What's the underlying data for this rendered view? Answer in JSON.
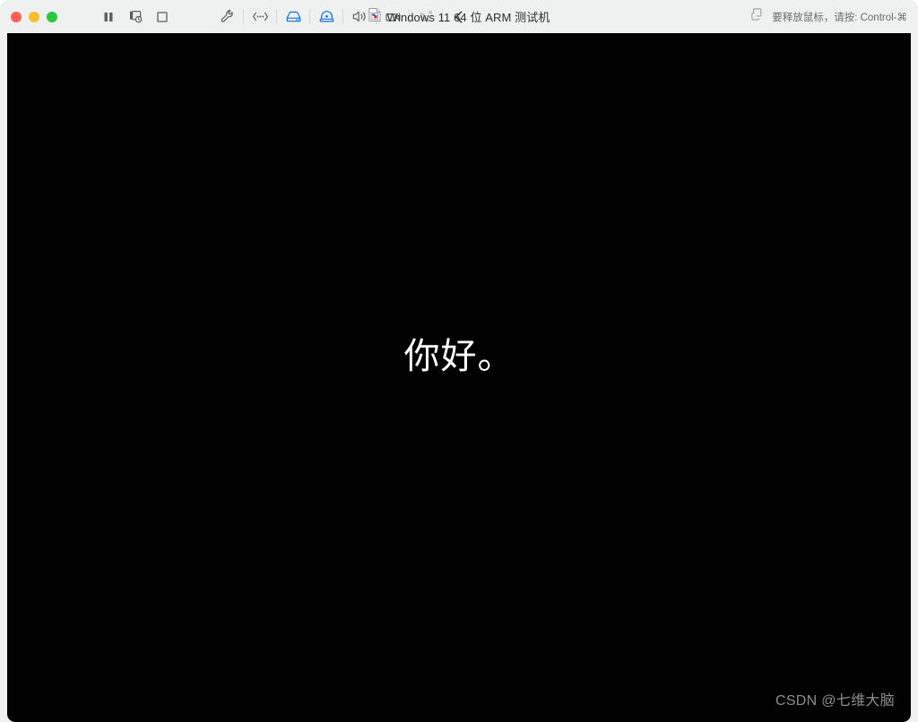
{
  "window": {
    "title": "Windows 11 64 位 ARM 测试机",
    "title_icon": "vm-document-icon",
    "traffic_lights": [
      {
        "name": "close",
        "label": "关闭",
        "color": "#ff5f57"
      },
      {
        "name": "minimize",
        "label": "最小化",
        "color": "#febc2e"
      },
      {
        "name": "maximize",
        "label": "全屏",
        "color": "#28c840"
      }
    ]
  },
  "toolbar": {
    "items": [
      {
        "name": "suspend-button",
        "icon": "pause-icon",
        "label": "挂起",
        "state": "normal"
      },
      {
        "name": "snapshot-button",
        "icon": "snapshot-icon",
        "label": "快照",
        "state": "normal"
      },
      {
        "name": "stop-button",
        "icon": "stop-icon",
        "label": "停止",
        "state": "normal"
      },
      {
        "name": "settings-button",
        "icon": "wrench-icon",
        "label": "设置",
        "state": "normal"
      },
      {
        "name": "network-button",
        "icon": "network-icon",
        "label": "网络适配器",
        "state": "normal"
      },
      {
        "name": "harddisk-button",
        "icon": "hard-drive-icon",
        "label": "硬盘",
        "state": "active"
      },
      {
        "name": "cd-drive-button",
        "icon": "cd-drive-icon",
        "label": "CD/DVD",
        "state": "active"
      },
      {
        "name": "sound-button",
        "icon": "speaker-icon",
        "label": "声卡",
        "state": "normal"
      },
      {
        "name": "camera-button",
        "icon": "camera-icon",
        "label": "摄像头",
        "state": "normal"
      },
      {
        "name": "phone-button",
        "icon": "phone-icon",
        "label": "电话",
        "state": "disabled"
      },
      {
        "name": "back-button",
        "icon": "chevron-left-icon",
        "label": "返回",
        "state": "normal"
      }
    ],
    "accent_color": "#1070e0",
    "icon_color": "#5a5d60",
    "disabled_color": "#b2b5b8"
  },
  "status": {
    "release_hint": "要释放鼠标，请按: Control-⌘",
    "release_hint_icon": "windows-copy-icon"
  },
  "guest": {
    "background_color": "#000000",
    "message": "你好。",
    "message_color": "#ffffff",
    "watermark": "CSDN @七维大脑",
    "watermark_color": "#8e8e8e"
  }
}
